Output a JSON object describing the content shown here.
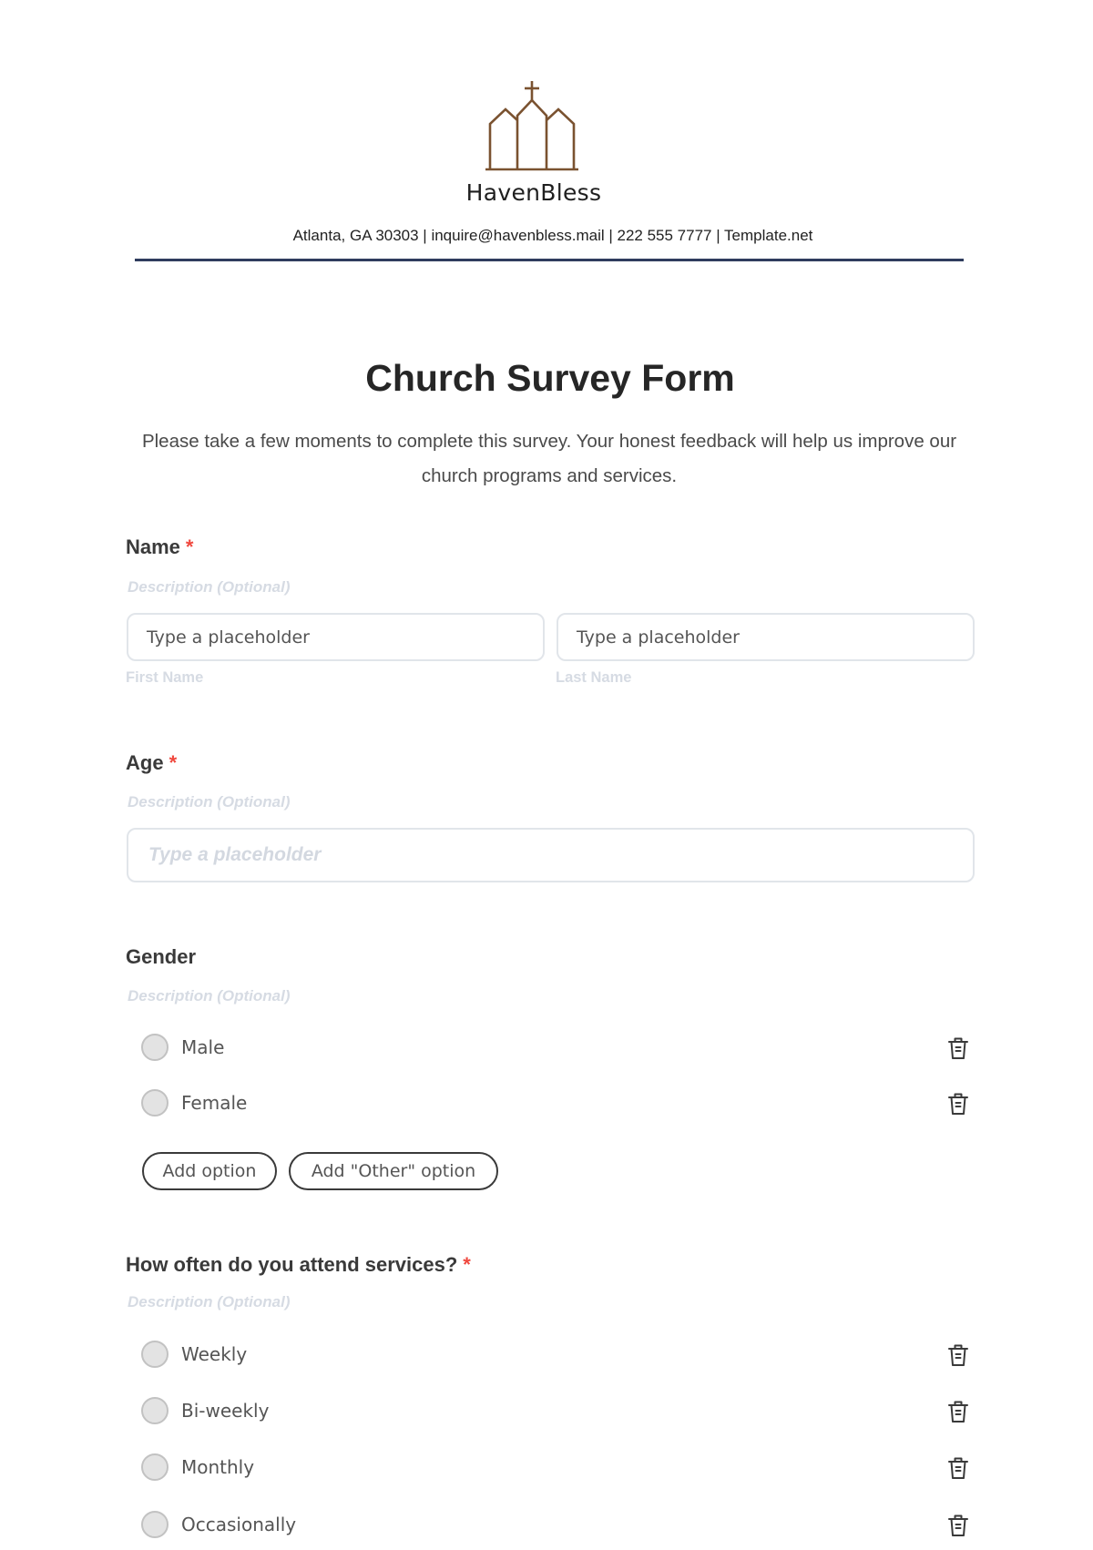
{
  "header": {
    "logo_icon": "church-icon",
    "brand_name": "HavenBless",
    "contact_line": "Atlanta, GA 30303 | inquire@havenbless.mail | 222 555 7777 | Template.net",
    "logo_color": "#7a5230",
    "rule_color": "#2f3c5e"
  },
  "form": {
    "title": "Church Survey Form",
    "intro": "Please take a few moments to complete this survey. Your honest feedback will help us improve our church programs and services.",
    "required_marker": "*",
    "fields": {
      "name": {
        "label": "Name",
        "required": true,
        "description": "Description (Optional)",
        "first_placeholder": "Type a placeholder",
        "last_placeholder": "Type a placeholder",
        "first_sublabel": "First Name",
        "last_sublabel": "Last Name"
      },
      "age": {
        "label": "Age",
        "required": true,
        "description": "Description (Optional)",
        "placeholder": "Type a placeholder"
      },
      "gender": {
        "label": "Gender",
        "required": false,
        "description": "Description (Optional)",
        "options": [
          "Male",
          "Female"
        ],
        "add_option_label": "Add option",
        "add_other_label": "Add \"Other\" option"
      },
      "attendance": {
        "label": "How often do you attend services?",
        "required": true,
        "description": "Description (Optional)",
        "options": [
          "Weekly",
          "Bi-weekly",
          "Monthly",
          "Occasionally"
        ]
      }
    }
  },
  "icons": {
    "option_delete": "trash-icon",
    "option_radio": "radio-unchecked"
  },
  "colors": {
    "required": "#f0483e",
    "muted_text": "#d6dbe3",
    "input_border": "#e1e5ea"
  }
}
